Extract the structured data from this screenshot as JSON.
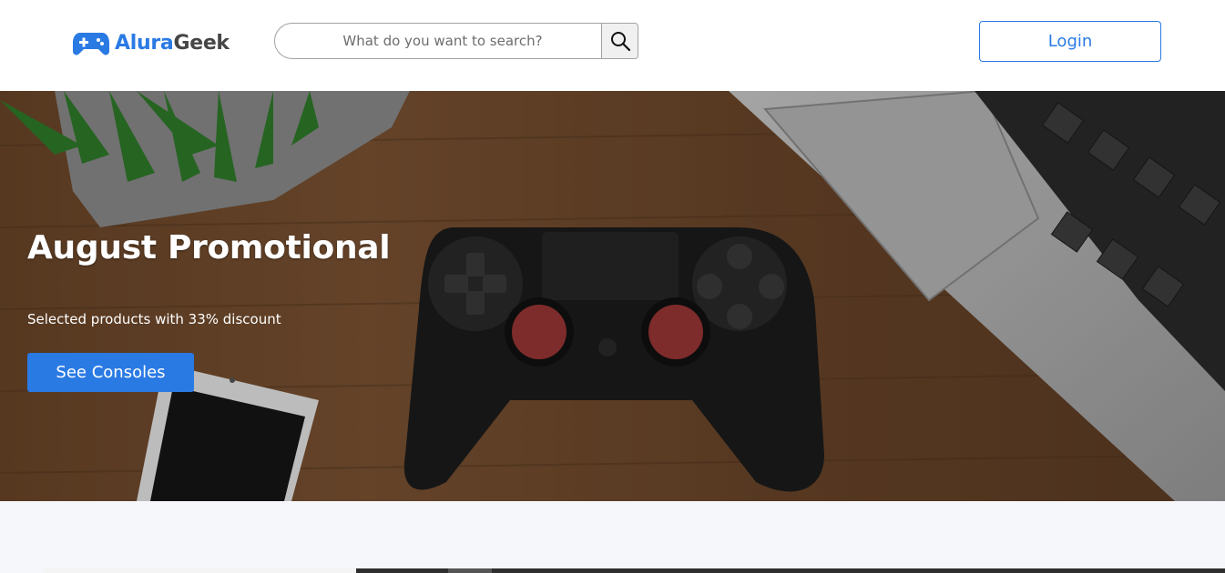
{
  "header": {
    "logo": {
      "part1": "Alura",
      "part2": "Geek",
      "icon": "gamepad-icon"
    },
    "search": {
      "placeholder": "What do you want to search?",
      "icon": "search-icon"
    },
    "login_label": "Login"
  },
  "banner": {
    "title": "August Promotional",
    "subtitle": "Selected products with 33% discount",
    "button_label": "See Consoles"
  },
  "colors": {
    "brand": "#2a7ae4",
    "text_dark": "#464646",
    "section_bg": "#f5f7fb"
  }
}
